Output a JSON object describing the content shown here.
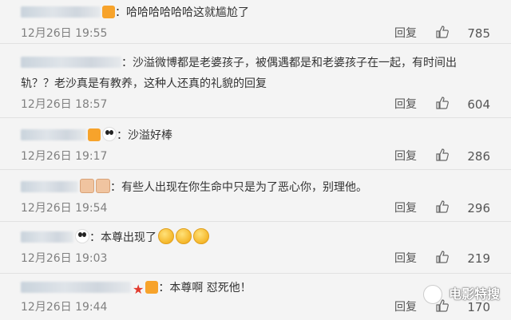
{
  "comments": [
    {
      "text": "：哈哈哈哈哈哈这就尴尬了",
      "time": "12月26日 19:55",
      "reply": "回复",
      "likes": "785"
    },
    {
      "text": "：沙溢微博都是老婆孩子，被偶遇都是和老婆孩子在一起，有时间出",
      "text2": "轨？？老沙真是有教养，这种人还真的礼貌的回复",
      "time": "12月26日 18:57",
      "reply": "回复",
      "likes": "604"
    },
    {
      "text": "：沙溢好棒",
      "time": "12月26日 19:17",
      "reply": "回复",
      "likes": "286"
    },
    {
      "text": "：有些人出现在你生命中只是为了恶心你，别理他。",
      "time": "12月26日 19:54",
      "reply": "回复",
      "likes": "296"
    },
    {
      "text": "：本尊出现了",
      "time": "12月26日 19:03",
      "reply": "回复",
      "likes": "219"
    },
    {
      "text": "：本尊啊 怼死他！",
      "time": "12月26日 19:44",
      "reply": "回复",
      "likes": "170"
    }
  ],
  "watermark": "电影特搜",
  "icons": {
    "like": "thumbs-up-icon",
    "vip": "vip-badge-icon",
    "panda": "panda-icon"
  }
}
